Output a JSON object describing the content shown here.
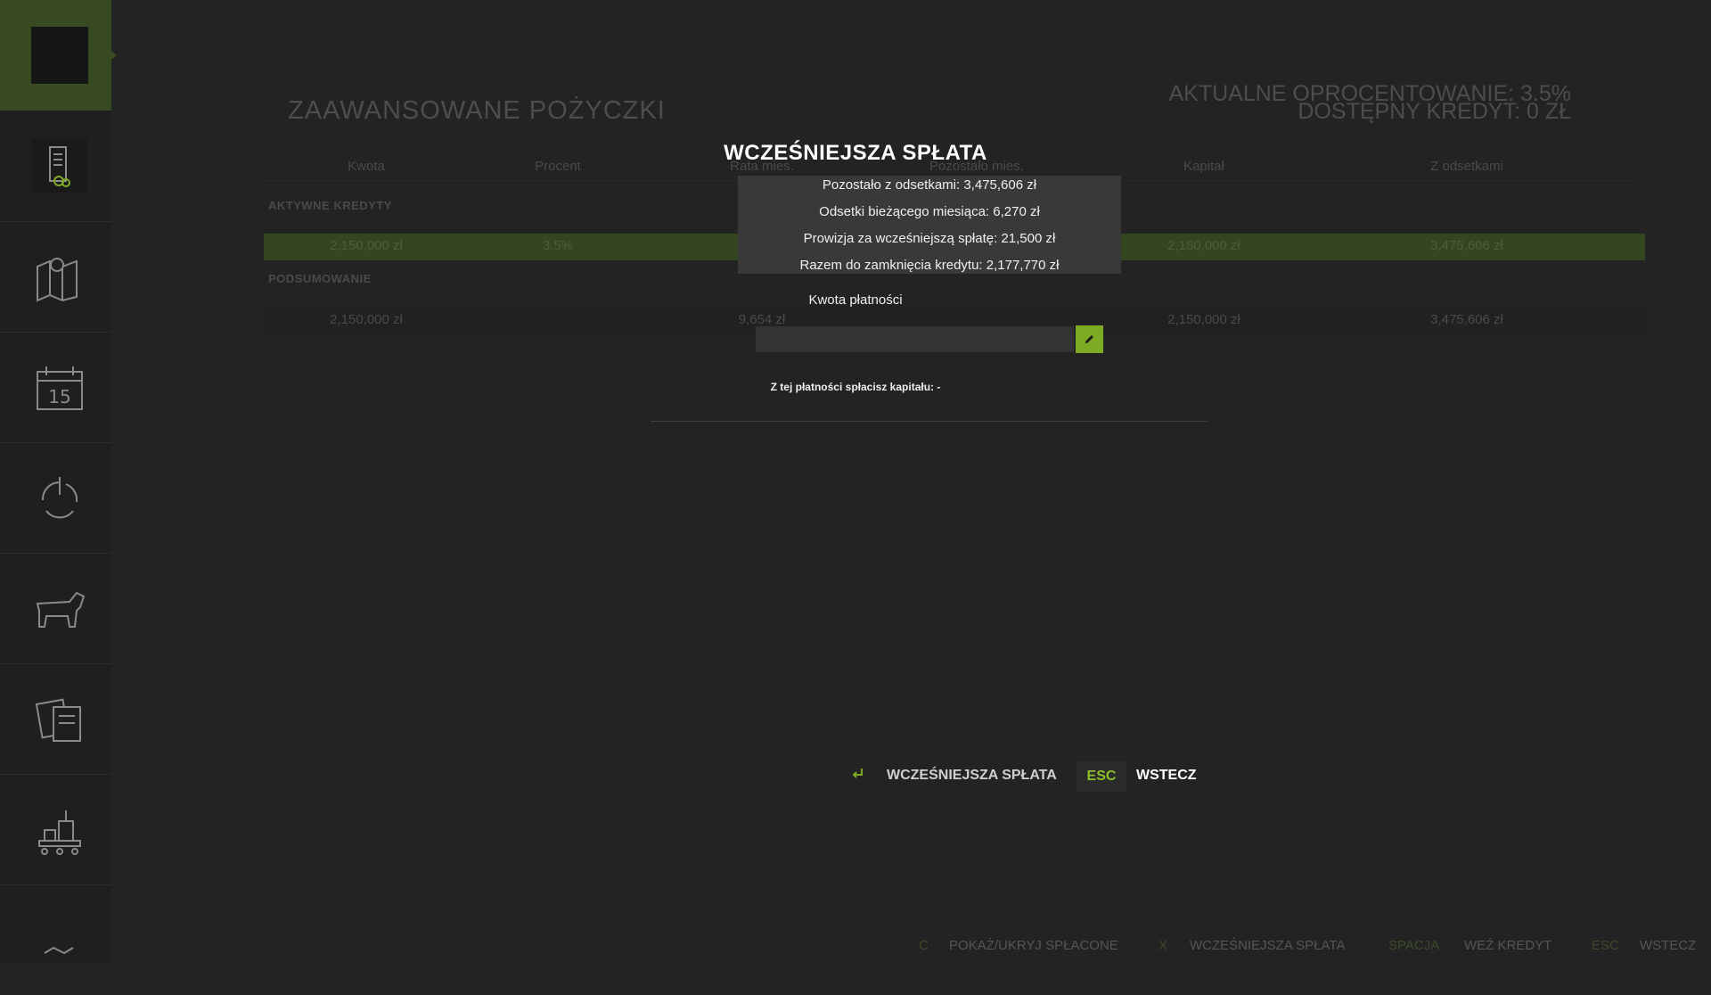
{
  "sidebar": {
    "items": [
      {
        "icon": "finance-document-icon"
      },
      {
        "icon": "map-icon"
      },
      {
        "icon": "calendar-icon",
        "text": "15"
      },
      {
        "icon": "crop-cycle-icon"
      },
      {
        "icon": "cow-icon"
      },
      {
        "icon": "contracts-icon"
      },
      {
        "icon": "production-icon"
      },
      {
        "icon": "chevron-icon"
      }
    ]
  },
  "background": {
    "title": "ZAAWANSOWANE POŻYCZKI",
    "rate_line": "AKTUALNE OPROCENTOWANIE: 3.5%",
    "credit_line": "DOSTĘPNY KREDYT: 0 ZŁ",
    "columns": [
      "Kwota",
      "Procent",
      "Rata mies.",
      "Pozostało mies.",
      "Kapitał",
      "Z odsetkami"
    ],
    "section_active": "AKTYWNE KREDYTY",
    "active_row": {
      "amount": "2,150,000 zł",
      "percent": "3.5%",
      "capital": "2,150,000 zł",
      "with_interest": "3,475,606 zł"
    },
    "section_summary": "PODSUMOWANIE",
    "summary_row": {
      "amount": "2,150,000 zł",
      "monthly": "9,654 zł",
      "capital": "2,150,000 zł",
      "with_interest": "3,475,606 zł"
    }
  },
  "modal": {
    "title": "WCZEŚNIEJSZA SPŁATA",
    "info": [
      "Pozostało z odsetkami: 3,475,606 zł",
      "Odsetki bieżącego miesiąca: 6,270 zł",
      "Prowizja za wcześniejszą spłatę: 21,500 zł",
      "Razem do zamknięcia kredytu: 2,177,770 zł"
    ],
    "amount_label": "Kwota płatności",
    "amount_value": "",
    "capital_note": "Z tej płatności spłacisz kapitału: -",
    "confirm_label": "WCZEŚNIEJSZA SPŁATA",
    "esc_key": "ESC",
    "back_label": "WSTECZ"
  },
  "bottom_bar": {
    "items": [
      {
        "key": "C",
        "label": "POKAŻ/UKRYJ SPŁACONE"
      },
      {
        "key": "X",
        "label": "WCZEŚNIEJSZA SPŁATA"
      },
      {
        "key": "SPACJA",
        "label": "WEŹ KREDYT"
      },
      {
        "key": "ESC",
        "label": "WSTECZ"
      }
    ]
  },
  "colors": {
    "accent": "#7eab24",
    "active_row": "#34461f",
    "sidebar_active": "#384a21"
  }
}
